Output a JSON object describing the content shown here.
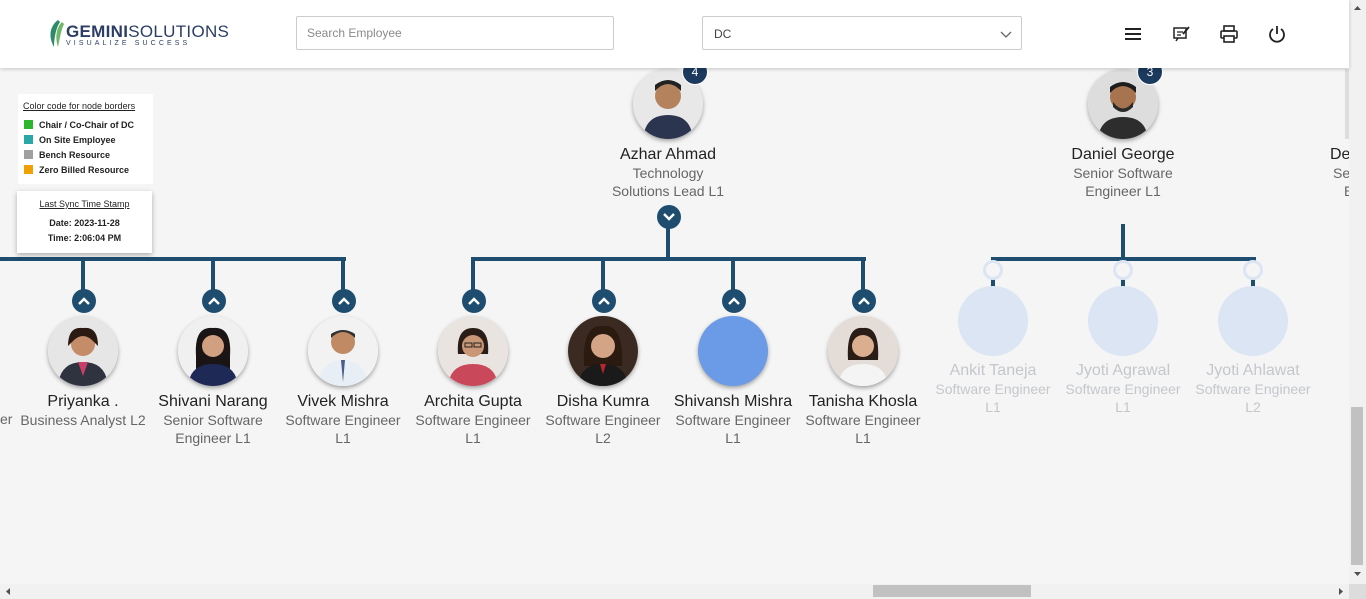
{
  "header": {
    "logo": {
      "brand_bold": "GEMINI",
      "brand_rest": "SOLUTIONS",
      "tagline": "VISUALIZE SUCCESS"
    },
    "search": {
      "placeholder": "Search Employee",
      "value": ""
    },
    "department_select": {
      "selected": "DC"
    },
    "icons": [
      "menu-icon",
      "feedback-icon",
      "print-icon",
      "power-icon"
    ]
  },
  "legend": {
    "title": "Color code for node borders",
    "items": [
      {
        "label": "Chair / Co-Chair of DC",
        "color": "#2db52d"
      },
      {
        "label": "On Site Employee",
        "color": "#2aa7a7"
      },
      {
        "label": "Bench Resource",
        "color": "#a0a0a0"
      },
      {
        "label": "Zero Billed Resource",
        "color": "#f0a000"
      }
    ]
  },
  "sync": {
    "title": "Last Sync Time Stamp",
    "date": "Date: 2023-11-28",
    "time": "Time: 2:06:04 PM"
  },
  "parents": [
    {
      "name": "Azhar Ahmad",
      "role": "Technology Solutions Lead L1",
      "reports": "4"
    },
    {
      "name": "Daniel George",
      "role": "Senior Software Engineer L1",
      "reports": "3"
    },
    {
      "name_partial": "De",
      "role_partial_1": "Se",
      "role_partial_2": "E"
    }
  ],
  "left_partial_role": "er",
  "children": [
    {
      "name": "Priyanka .",
      "role": "Business Analyst L2"
    },
    {
      "name": "Shivani Narang",
      "role": "Senior Software Engineer L1"
    },
    {
      "name": "Vivek Mishra",
      "role": "Software Engineer L1"
    },
    {
      "name": "Archita Gupta",
      "role": "Software Engineer L1"
    },
    {
      "name": "Disha Kumra",
      "role": "Software Engineer L2"
    },
    {
      "name": "Shivansh Mishra",
      "role": "Software Engineer L1"
    },
    {
      "name": "Tanisha Khosla",
      "role": "Software Engineer L1"
    }
  ],
  "faded_children": [
    {
      "name": "Ankit Taneja",
      "role": "Software Engineer L1"
    },
    {
      "name": "Jyoti Agrawal",
      "role": "Software Engineer L1"
    },
    {
      "name": "Jyoti Ahlawat",
      "role": "Software Engineer L2"
    }
  ],
  "colors": {
    "connector": "#1e4d6f",
    "badge": "#1b3a5e",
    "placeholder_photo": "#6b9be6"
  }
}
